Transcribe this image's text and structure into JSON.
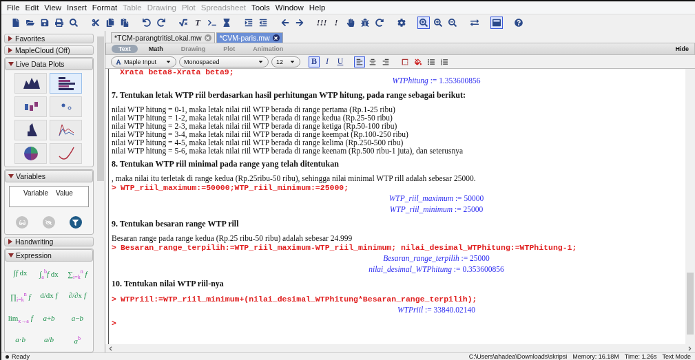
{
  "menu": [
    {
      "label": "File",
      "disabled": false
    },
    {
      "label": "Edit",
      "disabled": false
    },
    {
      "label": "View",
      "disabled": false
    },
    {
      "label": "Insert",
      "disabled": false
    },
    {
      "label": "Format",
      "disabled": false
    },
    {
      "label": "Table",
      "disabled": true
    },
    {
      "label": "Drawing",
      "disabled": true
    },
    {
      "label": "Plot",
      "disabled": true
    },
    {
      "label": "Spreadsheet",
      "disabled": true
    },
    {
      "label": "Tools",
      "disabled": false
    },
    {
      "label": "Window",
      "disabled": false
    },
    {
      "label": "Help",
      "disabled": false
    }
  ],
  "toolbar": [
    [
      {
        "pressed": false
      },
      {
        "pressed": false
      },
      {
        "pressed": false
      },
      {
        "pressed": false
      },
      {
        "pressed": false
      }
    ],
    [
      {
        "pressed": false
      },
      {
        "pressed": false
      },
      {
        "pressed": false
      }
    ],
    [
      {
        "pressed": false
      },
      {
        "pressed": false
      }
    ],
    [
      {
        "pressed": false
      },
      {
        "pressed": false,
        "glyph": "T"
      },
      {
        "pressed": false
      },
      {
        "pressed": false
      }
    ],
    [
      {
        "pressed": false
      },
      {
        "pressed": false
      }
    ],
    [
      {
        "pressed": false
      },
      {
        "pressed": false
      }
    ],
    [
      {
        "pressed": false,
        "glyph": "!!!"
      },
      {
        "pressed": false,
        "glyph": "!"
      },
      {
        "pressed": false
      },
      {
        "pressed": false
      },
      {
        "pressed": false
      }
    ],
    [
      {
        "pressed": false
      }
    ],
    [
      {
        "pressed": true
      },
      {
        "pressed": false
      },
      {
        "pressed": false
      }
    ],
    [
      {
        "pressed": false
      }
    ],
    [
      {
        "pressed": true
      }
    ],
    [
      {
        "pressed": false
      }
    ]
  ],
  "sidebar": {
    "sections": [
      {
        "kind": "header",
        "title": "Favorites",
        "expanded": false
      },
      {
        "kind": "header",
        "title": "MapleCloud (Off)",
        "expanded": false
      },
      {
        "kind": "plots",
        "title": "Live Data Plots",
        "expanded": true,
        "tiles": [
          {
            "selected": false
          },
          {
            "selected": true
          },
          {
            "selected": false
          },
          {
            "selected": false
          },
          {
            "selected": false
          },
          {
            "selected": false
          },
          {
            "selected": false
          },
          {
            "selected": false
          }
        ]
      },
      {
        "kind": "variables",
        "title": "Variables",
        "expanded": true,
        "columns": [
          "Variable",
          "Value"
        ],
        "buttons": [
          {
            "disabled": true
          },
          {
            "disabled": true
          },
          {
            "disabled": false
          }
        ]
      },
      {
        "kind": "header",
        "title": "Handwriting",
        "expanded": false
      },
      {
        "kind": "expression",
        "title": "Expression",
        "expanded": true,
        "items": [
          "∫*f* dx",
          "∫$_{a}$$^{b}$*f* dx",
          "∑$_{i=k}$$^{n}$ *f*",
          "∏$_{i=k}$$^{n}$ *f*",
          "d/dx *f*",
          "∂/∂x *f*",
          "lim$_{x→a}$ *f*",
          "*a*+*b*",
          "*a*−*b*",
          "*a*·*b*",
          "*a*/*b*",
          "*a*$^{b}$"
        ]
      }
    ]
  },
  "doc_tabs": [
    {
      "label": "*TCM-parangtritisLokal.mw",
      "selected": false
    },
    {
      "label": "*CVM-paris.mw",
      "selected": true
    }
  ],
  "modes": {
    "items": [
      {
        "label": "Text",
        "selected": true,
        "disabled": false
      },
      {
        "label": "Math",
        "selected": false,
        "disabled": false
      },
      {
        "label": "Drawing",
        "selected": false,
        "disabled": true
      },
      {
        "label": "Plot",
        "selected": false,
        "disabled": true
      },
      {
        "label": "Animation",
        "selected": false,
        "disabled": true
      }
    ],
    "hide": "Hide"
  },
  "format": {
    "style": "Maple Input",
    "font": "Monospaced",
    "size": "12",
    "styles": [
      {
        "glyph": "B",
        "pressed": true
      },
      {
        "glyph": "I",
        "pressed": false
      },
      {
        "glyph": "U",
        "pressed": false
      }
    ],
    "alignment": [
      {
        "selected": true
      },
      {
        "selected": false
      },
      {
        "selected": false
      }
    ]
  },
  "document": [
    {
      "kind": "input_cont",
      "text": "Xrata beta8-Xrata beta9;"
    },
    {
      "kind": "output",
      "text": "*WTPhitung* := 1.353600856"
    },
    {
      "kind": "heading",
      "text": "7.  Tentukan letak WTP riil berdasarkan hasil perhitungan WTP hitung, pada range sebagai berikut:"
    },
    {
      "kind": "text",
      "text": "nilai WTP hitung = 0-1, maka letak nilai riil WTP berada di range pertama (Rp.1-25 ribu)"
    },
    {
      "kind": "text",
      "text": "nilai WTP hitung = 1-2, maka letak nilai riil WTP berada di range kedua (Rp.25-50 ribu)"
    },
    {
      "kind": "text",
      "text": "nilai WTP hitung = 2-3, maka letak nilai riil WTP berada di range ketiga (Rp.50-100 ribu)"
    },
    {
      "kind": "text",
      "text": "nilai WTP hitung = 3-4, maka letak nilai riil WTP berada di range keempat (Rp.100-250 ribu)"
    },
    {
      "kind": "text",
      "text": "nilai WTP hitung = 4-5, maka letak nilai riil WTP berada di range kelima (Rp.250-500 ribu)"
    },
    {
      "kind": "text",
      "text": "nilai WTP hitung = 5-6, maka letak nilai riil WTP berada di range keenam (Rp.500 ribu-1 juta), dan seterusnya"
    },
    {
      "kind": "heading",
      "text": "8.  Tentukan WTP riil minimal pada range yang telah ditentukan"
    },
    {
      "kind": "text",
      "text": ", maka nilai itu terletak di range kedua (Rp.25ribu-50 ribu), sehingga nilai minimal WTP rill adalah sebesar 25000."
    },
    {
      "kind": "input",
      "text": "WTP_riil_maximum:=50000;WTP_riil_minimum:=25000;"
    },
    {
      "kind": "output",
      "text": "*WTP_riil_maximum* := 50000"
    },
    {
      "kind": "output",
      "text": "*WTP_riil_minimum* := 25000"
    },
    {
      "kind": "heading",
      "text": "9.  Tentukan besaran range WTP rill"
    },
    {
      "kind": "text",
      "text": "Besaran range pada range kedua (Rp.25 ribu-50 ribu) adalah sebesar 24.999"
    },
    {
      "kind": "input",
      "text": "Besaran_range_terpilih:=WTP_riil_maximum-WTP_riil_minimum; nilai_desimal_WTPhitung:=WTPhitung-1;"
    },
    {
      "kind": "output",
      "text": "*Besaran_range_terpilih* := 25000"
    },
    {
      "kind": "output",
      "text": "*nilai_desimal_WTPhitung* := 0.353600856"
    },
    {
      "kind": "heading",
      "text": "10.  Tentukan nilai WTP riil-nya"
    },
    {
      "kind": "input",
      "text": "WTPriil:=WTP_riil_minimum+(nilai_desimal_WTPhitung*Besaran_range_terpilih);"
    },
    {
      "kind": "output",
      "text": "*WTPriil* := 33840.02140"
    },
    {
      "kind": "prompt_line"
    }
  ],
  "prompt": ">",
  "status": {
    "message": "Ready",
    "path": "C:\\Users\\ahadea\\Downloads\\skripsi",
    "memory": "Memory: 16.18M",
    "time": "Time: 1.26s",
    "mode": "Text Mode"
  }
}
